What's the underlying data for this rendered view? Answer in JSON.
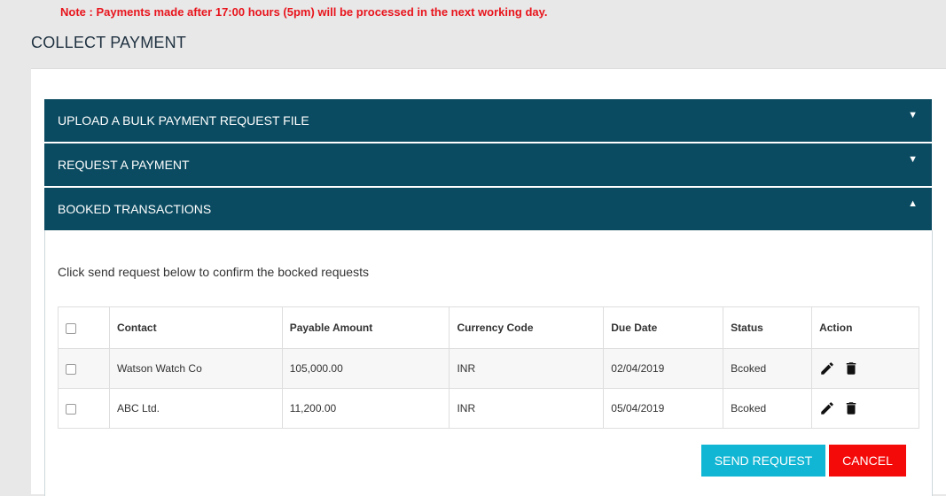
{
  "note": "Note : Payments made after 17:00 hours (5pm) will be processed in the next working day.",
  "page_title": "COLLECT PAYMENT",
  "accordion": [
    {
      "label": "UPLOAD A BULK PAYMENT REQUEST FILE",
      "arrow": "▼"
    },
    {
      "label": "REQUEST A PAYMENT",
      "arrow": "▼"
    },
    {
      "label": "BOOKED TRANSACTIONS",
      "arrow": "▲"
    }
  ],
  "instruction": "Click send request below to confirm the bocked requests",
  "table": {
    "headers": [
      "Contact",
      "Payable Amount",
      "Currency Code",
      "Due Date",
      "Status",
      "Action"
    ],
    "rows": [
      {
        "contact": "Watson Watch Co",
        "amount": "105,000.00",
        "currency": "INR",
        "due": "02/04/2019",
        "status": "Bcoked"
      },
      {
        "contact": "ABC Ltd.",
        "amount": "11,200.00",
        "currency": "INR",
        "due": "05/04/2019",
        "status": "Bcoked"
      }
    ]
  },
  "buttons": {
    "send": "SEND REQUEST",
    "cancel": "CANCEL"
  },
  "icons": {
    "edit": "pencil-icon",
    "delete": "trash-icon"
  },
  "colors": {
    "header_bar": "#0b4b61",
    "send": "#11b6d4",
    "cancel": "#f50a0a",
    "note": "#e8141c"
  }
}
